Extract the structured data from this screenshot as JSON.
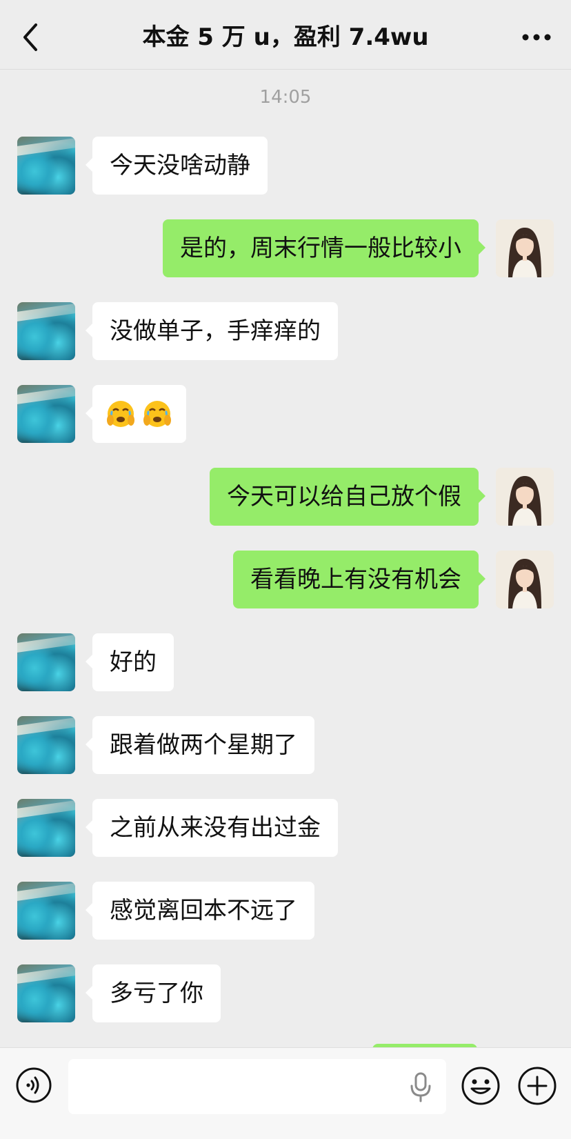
{
  "header": {
    "title": "本金 5 万 u，盈利 7.4wu",
    "back_icon": "chevron-left-icon",
    "more_icon": "more-horizontal-icon"
  },
  "chat": {
    "timestamp": "14:05",
    "messages": [
      {
        "side": "left",
        "text": "今天没啥动静"
      },
      {
        "side": "right",
        "text": "是的，周末行情一般比较小"
      },
      {
        "side": "left",
        "text": "没做单子，手痒痒的"
      },
      {
        "side": "left",
        "text": "",
        "emoji": [
          "face-holding-back-tears",
          "face-holding-back-tears"
        ]
      },
      {
        "side": "right",
        "text": "今天可以给自己放个假"
      },
      {
        "side": "right",
        "text": "看看晚上有没有机会"
      },
      {
        "side": "left",
        "text": "好的"
      },
      {
        "side": "left",
        "text": "跟着做两个星期了"
      },
      {
        "side": "left",
        "text": "之前从来没有出过金"
      },
      {
        "side": "left",
        "text": "感觉离回本不远了"
      },
      {
        "side": "left",
        "text": "多亏了你"
      }
    ]
  },
  "input_bar": {
    "voice_icon": "voice-icon",
    "mic_icon": "microphone-icon",
    "emoji_icon": "smiley-icon",
    "plus_icon": "plus-icon",
    "input_value": "",
    "placeholder": ""
  },
  "colors": {
    "background": "#ededed",
    "bubble_self": "#95ec69",
    "bubble_other": "#ffffff",
    "timestamp": "#a0a0a0"
  }
}
